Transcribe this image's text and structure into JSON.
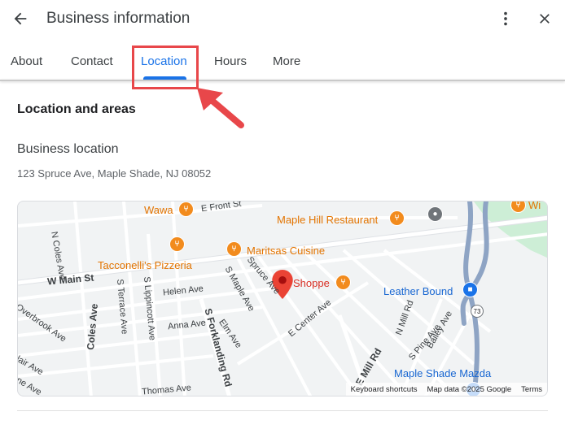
{
  "header": {
    "title": "Business information"
  },
  "tabs": [
    {
      "label": "About"
    },
    {
      "label": "Contact"
    },
    {
      "label": "Location"
    },
    {
      "label": "Hours"
    },
    {
      "label": "More"
    }
  ],
  "active_tab": "Location",
  "content": {
    "section_title": "Location and areas",
    "business_location_heading": "Business location",
    "address": "123 Spruce Ave, Maple Shade, NJ 08052"
  },
  "map": {
    "pois": {
      "wawa": "Wawa",
      "maple_hill": "Maple Hill Restaurant",
      "maritsas": "Maritsas Cuisine",
      "tacconellis": "Tacconelli's Pizzeria",
      "shoppe": "Shoppe",
      "leather_bound": "Leather Bound",
      "maple_shade_mazda": "Maple Shade Mazda",
      "edge_poi": "Wi"
    },
    "streets": {
      "e_front": "E Front St",
      "n_coles": "N Coles Ave",
      "w_main": "W Main St",
      "s_terrace": "S Terrace Ave",
      "s_lippincott": "S Lippincott Ave",
      "helen": "Helen Ave",
      "s_maple": "S Maple Ave",
      "spruce": "Spruce Ave",
      "e_center": "E Center Ave",
      "overbrook": "Overbrook Ave",
      "anna": "Anna Ave",
      "elm": "Elm Ave",
      "s_forklanding": "S Forklanding Rd",
      "coles": "Coles Ave",
      "e_mill": "E Mill Rd",
      "n_mill": "N Mill Rd",
      "bailey": "Bailey Ave",
      "s_pine": "S Pine Ave",
      "thomas": "Thomas Ave",
      "lair": "lair Ave",
      "ne": "ne Ave",
      "route_73": "73"
    },
    "footer": {
      "shortcuts": "Keyboard shortcuts",
      "attribution": "Map data ©2025 Google",
      "terms": "Terms"
    }
  },
  "colors": {
    "accent": "#1a73e8",
    "highlight": "#e8474a",
    "marker": "#ea4335",
    "poi_orange": "#e37400"
  }
}
